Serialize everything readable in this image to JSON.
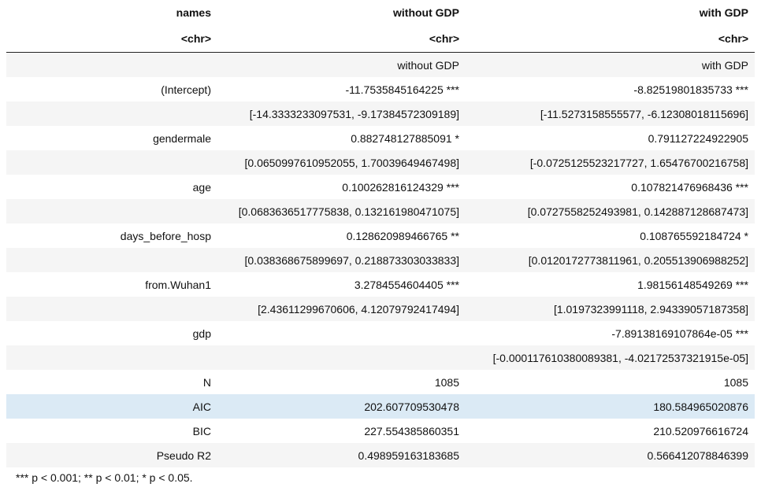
{
  "header": {
    "col_names": [
      "names",
      "without GDP",
      "with GDP"
    ],
    "col_types": [
      "<chr>",
      "<chr>",
      "<chr>"
    ]
  },
  "rows": [
    [
      "",
      "without GDP",
      "with GDP"
    ],
    [
      "(Intercept)",
      "-11.7535845164225 ***",
      "-8.82519801835733 ***"
    ],
    [
      "",
      "[-14.3333233097531, -9.17384572309189]",
      "[-11.5273158555577, -6.12308018115696]"
    ],
    [
      "gendermale",
      "0.882748127885091 *",
      "0.791127224922905"
    ],
    [
      "",
      "[0.0650997610952055, 1.70039649467498]",
      "[-0.0725125523217727, 1.65476700216758]"
    ],
    [
      "age",
      "0.100262816124329 ***",
      "0.107821476968436 ***"
    ],
    [
      "",
      "[0.0683636517775838, 0.132161980471075]",
      "[0.0727558252493981, 0.142887128687473]"
    ],
    [
      "days_before_hosp",
      "0.128620989466765 **",
      "0.108765592184724 *"
    ],
    [
      "",
      "[0.038368675899697, 0.218873303033833]",
      "[0.0120172773811961, 0.205513906988252]"
    ],
    [
      "from.Wuhan1",
      "3.2784554604405 ***",
      "1.98156148549269 ***"
    ],
    [
      "",
      "[2.43611299670606, 4.12079792417494]",
      "[1.0197323991118, 2.94339057187358]"
    ],
    [
      "gdp",
      "",
      "-7.89138169107864e-05 ***"
    ],
    [
      "",
      "",
      "[-0.000117610380089381, -4.02172537321915e-05]"
    ],
    [
      "N",
      "1085",
      "1085"
    ],
    [
      "AIC",
      "202.607709530478",
      "180.584965020876"
    ],
    [
      "BIC",
      "227.554385860351",
      "210.520976616724"
    ],
    [
      "Pseudo R2",
      "0.498959163183685",
      "0.566412078846399"
    ]
  ],
  "highlighted_row_label": "AIC",
  "footnote": "*** p < 0.001;  ** p < 0.01;  * p < 0.05."
}
